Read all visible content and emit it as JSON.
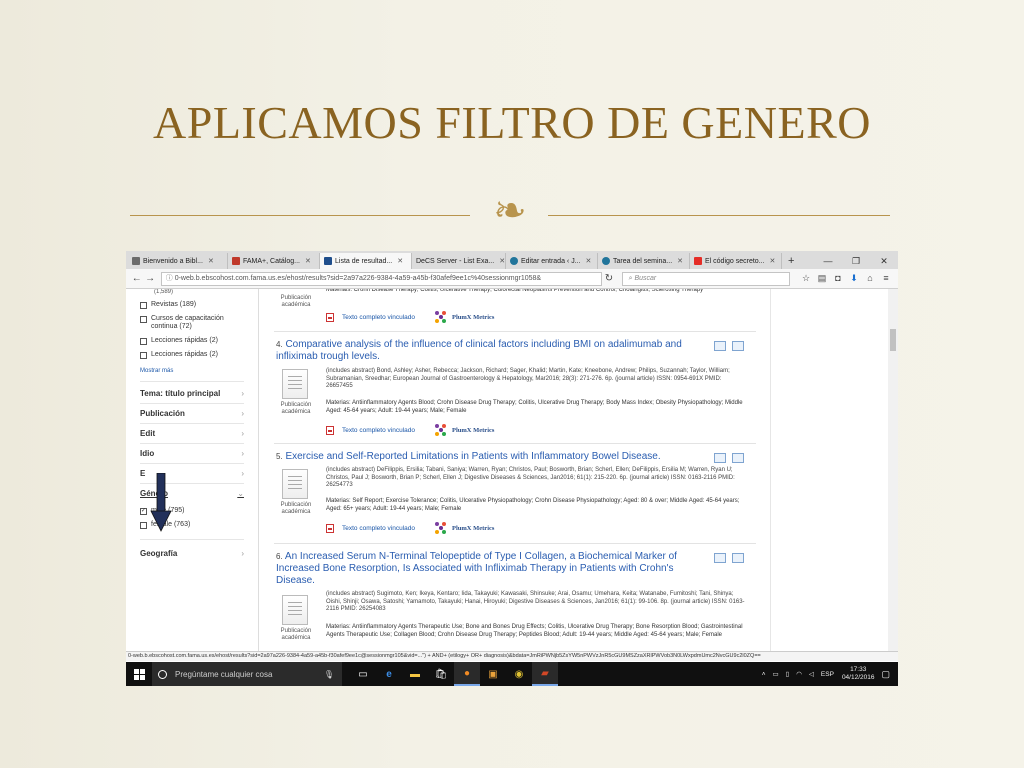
{
  "slide": {
    "title": "APLICAMOS FILTRO DE GENERO",
    "ornament": "❧"
  },
  "browser": {
    "tabs": [
      {
        "label": "Bienvenido a Bibl...",
        "icon": "library-icon",
        "color": "#6b6b6b"
      },
      {
        "label": "FAMA+, Catálog...",
        "icon": "fama-icon",
        "color": "#c0392b"
      },
      {
        "label": "Lista de resultad...",
        "icon": "ebsco-icon",
        "color": "#1f4e8c",
        "active": true
      },
      {
        "label": "DeCS Server - List Exa...",
        "icon": "decs-icon",
        "color": "#ffffff"
      },
      {
        "label": "Editar entrada ‹ J...",
        "icon": "wordpress-icon",
        "color": "#21759b"
      },
      {
        "label": "Tarea del semina...",
        "icon": "wordpress-icon",
        "color": "#21759b"
      },
      {
        "label": "El código secreto...",
        "icon": "youtube-icon",
        "color": "#e52d27"
      }
    ],
    "new_tab": "+",
    "url": "0-web.b.ebscohost.com.fama.us.es/ehost/results?sid=2a97a226-9384-4a59-a45b-f30afef9ee1c%40sessionmgr1058&",
    "search_placeholder": "Buscar",
    "status_url": "0-web.b.ebscohost.com.fama.us.es/ehost/results?sid=2a97a226-9384-4a59-a45b-f30afef9ee1c@sessionmgr105&vid=...\") + AND+ (etilogy+ OR+ diagnosis)&bdata=JmRiPWNjb5ZsYW5nPWVzJnR5cGU9MSZzaXRlPWVob3N0LWxpdmUmc2NvcGU9c2l0ZQ=="
  },
  "sidebar": {
    "top_count": "(1,589)",
    "sources": [
      {
        "label": "Revistas (189)"
      },
      {
        "label": "Cursos de capacitación continua (72)"
      },
      {
        "label": "Lecciones rápidas (2)"
      },
      {
        "label": "Lecciones rápidas (2)"
      }
    ],
    "show_more": "Mostrar más",
    "facets": [
      {
        "label": "Tema: título principal"
      },
      {
        "label": "Publicación"
      },
      {
        "label": "Edit"
      },
      {
        "label": "Idio"
      },
      {
        "label": "E"
      }
    ],
    "genero": {
      "label": "Género",
      "options": [
        {
          "label": "male (795)",
          "checked": true
        },
        {
          "label": "female (763)",
          "checked": false
        }
      ]
    },
    "geografia": "Geografía"
  },
  "results": {
    "pub_type": "Publicación académica",
    "fulltext_label": "Texto completo vinculado",
    "plumx_label": "PlumX Metrics",
    "top_fragment": {
      "subjects": "Materials: Crohn Disease Therapy; Colitis, Ulcerative Therapy; Colorectal Neoplasms Prevention and Control; Cholangitis, Sclerosing Therapy"
    },
    "items": [
      {
        "num": "4.",
        "title": "Comparative analysis of the influence of clinical factors including BMI on adalimumab and infliximab trough levels.",
        "meta": "(includes abstract) Bond, Ashley; Asher, Rebecca; Jackson, Richard; Sager, Khalid; Martin, Kate; Kneebone, Andrew; Philips, Suzannah; Taylor, William; Subramanian, Sreedhar; European Journal of Gastroenterology & Hepatology, Mar2016; 28(3): 271-276. 6p. (journal article) ISSN: 0954-691X PMID: 26657455",
        "subjects": "Materias: Antiinflammatory Agents Blood; Crohn Disease Drug Therapy; Colitis, Ulcerative Drug Therapy; Body Mass Index; Obesity Physiopathology; Middle Aged: 45-64 years; Adult: 19-44 years; Male; Female"
      },
      {
        "num": "5.",
        "title": "Exercise and Self-Reported Limitations in Patients with Inflammatory Bowel Disease.",
        "meta": "(includes abstract) DeFilippis, Ersilia; Tabani, Saniya; Warren, Ryan; Christos, Paul; Bosworth, Brian; Scherl, Ellen; DeFilippis, Ersilia M; Warren, Ryan U; Christos, Paul J; Bosworth, Brian P; Scherl, Ellen J; Digestive Diseases & Sciences, Jan2016; 61(1): 215-220. 6p. (journal article) ISSN: 0163-2116 PMID: 26254773",
        "subjects": "Materias: Self Report; Exercise Tolerance; Colitis, Ulcerative Physiopathology; Crohn Disease Physiopathology; Aged: 80 & over; Middle Aged: 45-64 years; Aged: 65+ years; Adult: 19-44 years; Male; Female"
      },
      {
        "num": "6.",
        "title": "An Increased Serum N-Terminal Telopeptide of Type I Collagen, a Biochemical Marker of Increased Bone Resorption, Is Associated with Infliximab Therapy in Patients with Crohn's Disease.",
        "meta": "(includes abstract) Sugimoto, Ken; Ikeya, Kentaro; Iida, Takayuki; Kawasaki, Shinsuke; Arai, Osamu; Umehara, Keita; Watanabe, Fumitoshi; Tani, Shinya; Oishi, Shinji; Osawa, Satoshi; Yamamoto, Takayuki; Hanai, Hiroyuki; Digestive Diseases & Sciences, Jan2016; 61(1): 99-106. 8p. (journal article) ISSN: 0163-2116 PMID: 26254083",
        "subjects": "Materias: Antiinflammatory Agents Therapeutic Use; Bone and Bones Drug Effects; Colitis, Ulcerative Drug Therapy; Bone Resorption Blood; Gastrointestinal Agents Therapeutic Use; Collagen Blood; Crohn Disease Drug Therapy; Peptides Blood; Adult: 19-44 years; Middle Aged: 45-64 years; Male; Female"
      }
    ]
  },
  "taskbar": {
    "search_placeholder": "Pregúntame cualquier cosa",
    "lang": "ESP",
    "time": "17:33",
    "date": "04/12/2016"
  }
}
